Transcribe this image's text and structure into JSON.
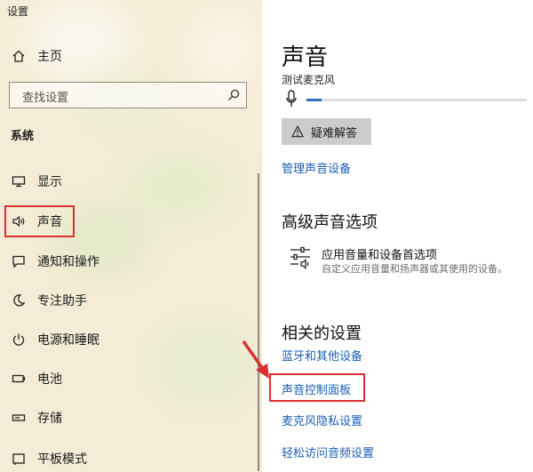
{
  "window": {
    "title": "设置"
  },
  "sidebar": {
    "home_label": "主页",
    "search_placeholder": "查找设置",
    "section": "系统",
    "items": [
      {
        "label": "显示",
        "icon": "monitor-icon"
      },
      {
        "label": "声音",
        "icon": "speaker-icon",
        "selected": true
      },
      {
        "label": "通知和操作",
        "icon": "message-icon"
      },
      {
        "label": "专注助手",
        "icon": "moon-icon"
      },
      {
        "label": "电源和睡眠",
        "icon": "power-icon"
      },
      {
        "label": "电池",
        "icon": "battery-icon"
      },
      {
        "label": "存储",
        "icon": "storage-icon"
      },
      {
        "label": "平板模式",
        "icon": "tablet-icon"
      }
    ]
  },
  "main": {
    "title": "声音",
    "mic_label": "测试麦克风",
    "mic_level": 0.07,
    "troubleshoot_label": "疑难解答",
    "manage_devices_link": "管理声音设备",
    "advanced": {
      "heading": "高级声音选项",
      "item_title": "应用音量和设备首选项",
      "item_subtitle": "自定义应用音量和扬声器或其使用的设备。"
    },
    "related": {
      "heading": "相关的设置",
      "links": [
        "蓝牙和其他设备",
        "声音控制面板",
        "麦克风隐私设置",
        "轻松访问音频设置"
      ]
    }
  },
  "annotations": {
    "highlight_color": "#d93030",
    "link_color": "#1a5fb4"
  }
}
